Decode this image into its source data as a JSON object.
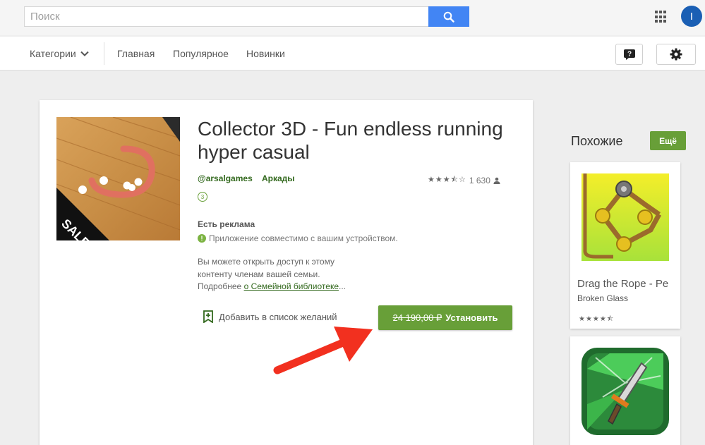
{
  "search": {
    "placeholder": "Поиск"
  },
  "account": {
    "initial": "I"
  },
  "nav": {
    "categories": "Категории",
    "links": [
      "Главная",
      "Популярное",
      "Новинки"
    ]
  },
  "app": {
    "title": "Collector 3D - Fun endless running hyper casual",
    "developer": "@arsalgames",
    "category": "Аркады",
    "rating_count": "1 630",
    "age_rating": "3",
    "sale_badge": "SALE",
    "ads_label": "Есть реклама",
    "compatibility": "Приложение совместимо с вашим устройством.",
    "family_text": "Вы можете открыть доступ к этому контенту членам вашей семьи. Подробнее ",
    "family_link": "о Семейной библиотеке",
    "family_ellipsis": "...",
    "wishlist": "Добавить в список желаний",
    "old_price": "24 190,00 ₽",
    "install": "Установить"
  },
  "similar": {
    "title": "Похожие",
    "more": "Ещё",
    "items": [
      {
        "name": "Drag the Rope - Pe",
        "developer": "Broken Glass"
      }
    ]
  },
  "colors": {
    "green": "#689f38",
    "link_green": "#33691e",
    "search_blue": "#4285f4",
    "arrow_red": "#f2301f"
  }
}
